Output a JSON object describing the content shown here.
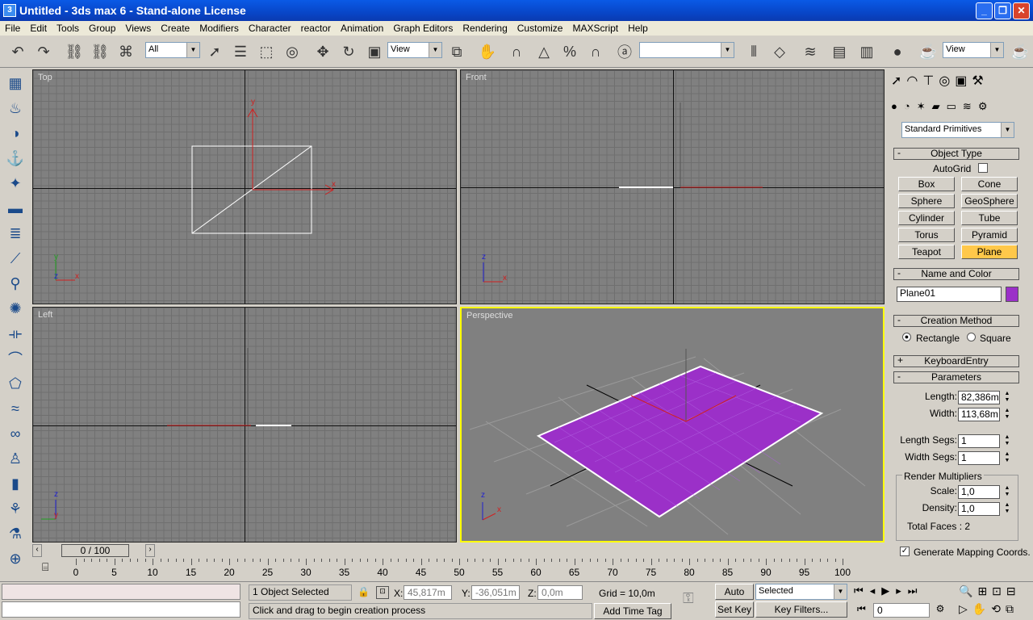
{
  "window": {
    "title": "Untitled - 3ds max 6 - Stand-alone License",
    "app_icon": "3"
  },
  "menu": [
    "File",
    "Edit",
    "Tools",
    "Group",
    "Views",
    "Create",
    "Modifiers",
    "Character",
    "reactor",
    "Animation",
    "Graph Editors",
    "Rendering",
    "Customize",
    "MAXScript",
    "Help"
  ],
  "toolbar": {
    "selection_filter": "All",
    "ref_coord": "View",
    "render_view": "View"
  },
  "viewports": {
    "top": "Top",
    "front": "Front",
    "left": "Left",
    "perspective": "Perspective"
  },
  "axis_letters": {
    "x": "x",
    "y": "y",
    "z": "z"
  },
  "command_panel": {
    "category": "Standard Primitives",
    "object_type": {
      "header": "Object Type",
      "autogrid": "AutoGrid",
      "buttons": [
        "Box",
        "Cone",
        "Sphere",
        "GeoSphere",
        "Cylinder",
        "Tube",
        "Torus",
        "Pyramid",
        "Teapot",
        "Plane"
      ],
      "active": "Plane"
    },
    "name_color": {
      "header": "Name and Color",
      "name": "Plane01",
      "color": "#9b30c8"
    },
    "creation_method": {
      "header": "Creation Method",
      "rectangle": "Rectangle",
      "square": "Square",
      "selected": "Rectangle"
    },
    "keyboard_entry": {
      "header": "KeyboardEntry",
      "sign": "+"
    },
    "parameters": {
      "header": "Parameters",
      "length_label": "Length:",
      "length": "82,386m",
      "width_label": "Width:",
      "width": "113,68m",
      "length_segs_label": "Length Segs:",
      "length_segs": "1",
      "width_segs_label": "Width Segs:",
      "width_segs": "1",
      "render_mult": "Render Multipliers",
      "scale_label": "Scale:",
      "scale": "1,0",
      "density_label": "Density:",
      "density": "1,0",
      "total_faces": "Total Faces : 2",
      "gen_mapping": "Generate Mapping Coords."
    }
  },
  "timeline": {
    "position": "0 / 100",
    "ticks": [
      "0",
      "5",
      "10",
      "15",
      "20",
      "25",
      "30",
      "35",
      "40",
      "45",
      "50",
      "55",
      "60",
      "65",
      "70",
      "75",
      "80",
      "85",
      "90",
      "95",
      "100"
    ]
  },
  "status": {
    "selected": "1 Object Selected",
    "prompt": "Click and drag to begin creation process",
    "x_label": "X:",
    "x": "45,817m",
    "y_label": "Y:",
    "y": "-36,051m",
    "z_label": "Z:",
    "z": "0,0m",
    "grid": "Grid = 10,0m",
    "add_time_tag": "Add Time Tag",
    "auto_key": "Auto Key",
    "set_key": "Set Key",
    "key_mode": "Selected",
    "key_filters": "Key Filters...",
    "frame": "0"
  },
  "colors": {
    "accent_active": "#ffc84a",
    "viewport_bg": "#808080",
    "active_border": "#ffff00",
    "plane": "#9b30c8"
  }
}
